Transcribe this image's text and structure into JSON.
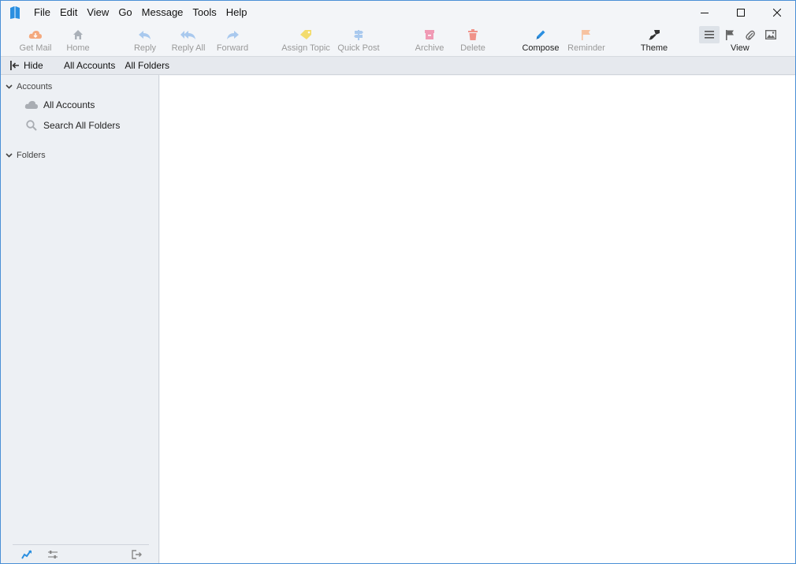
{
  "menu": {
    "items": [
      "File",
      "Edit",
      "View",
      "Go",
      "Message",
      "Tools",
      "Help"
    ]
  },
  "toolbar": {
    "get_mail": "Get Mail",
    "home": "Home",
    "reply": "Reply",
    "reply_all": "Reply All",
    "forward": "Forward",
    "assign_topic": "Assign Topic",
    "quick_post": "Quick Post",
    "archive": "Archive",
    "delete": "Delete",
    "compose": "Compose",
    "reminder": "Reminder",
    "theme": "Theme",
    "view": "View"
  },
  "subbar": {
    "hide": "Hide",
    "all_accounts": "All Accounts",
    "all_folders": "All Folders"
  },
  "sidebar": {
    "accounts_header": "Accounts",
    "all_accounts": "All Accounts",
    "search_all_folders": "Search All Folders",
    "folders_header": "Folders"
  },
  "colors": {
    "accent": "#2b8fe0",
    "window_border": "#4a8fd6",
    "get_mail_icon": "#f4a97e",
    "assign_topic_icon": "#f3dc6e",
    "archive_icon": "#f09ab5",
    "delete_icon": "#f0938a",
    "reminder_icon": "#f7c2a0",
    "reply_icon": "#a9c9ee"
  },
  "icons": {
    "app": "mail-book-icon",
    "get_mail": "download-cloud-icon",
    "home": "home-icon",
    "reply": "reply-icon",
    "reply_all": "reply-all-icon",
    "forward": "forward-icon",
    "assign_topic": "tag-icon",
    "quick_post": "signpost-icon",
    "archive": "archive-box-icon",
    "delete": "trash-icon",
    "compose": "pencil-icon",
    "reminder": "flag-icon",
    "theme": "paintbrush-icon"
  }
}
